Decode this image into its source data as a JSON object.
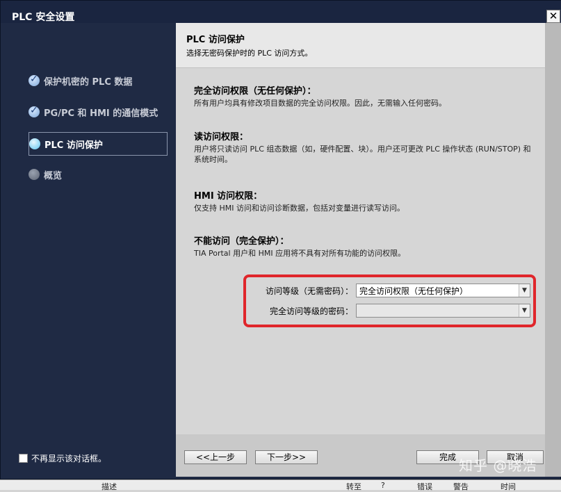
{
  "window": {
    "title": "PLC 安全设置",
    "close_label": "✕"
  },
  "sidebar": {
    "items": [
      {
        "label": "保护机密的 PLC 数据",
        "state": "done"
      },
      {
        "label": "PG/PC 和 HMI 的通信模式",
        "state": "done"
      },
      {
        "label": "PLC 访问保护",
        "state": "active"
      },
      {
        "label": "概览",
        "state": "pending"
      }
    ],
    "dont_show_label": "不再显示该对话框。"
  },
  "header": {
    "title": "PLC 访问保护",
    "subtitle": "选择无密码保护时的 PLC 访问方式。"
  },
  "sections": [
    {
      "title": "完全访问权限（无任何保护）：",
      "desc": "所有用户均具有修改项目数据的完全访问权限。因此，无需输入任何密码。"
    },
    {
      "title": "读访问权限：",
      "desc": "用户将只读访问 PLC 组态数据（如，硬件配置、块）。用户还可更改 PLC 操作状态 (RUN/STOP) 和系统时间。"
    },
    {
      "title": "HMI 访问权限：",
      "desc": "仅支持 HMI 访问和访问诊断数据，包括对变量进行读写访问。"
    },
    {
      "title": "不能访问（完全保护）：",
      "desc": "TIA Portal 用户和 HMI 应用将不具有对所有功能的访问权限。"
    }
  ],
  "form": {
    "level_label": "访问等级（无需密码）：",
    "level_value": "完全访问权限（无任何保护）",
    "password_label": "完全访问等级的密码：",
    "password_value": ""
  },
  "buttons": {
    "prev": "<<上一步",
    "next": "下一步>>",
    "finish": "完成",
    "cancel": "取消"
  },
  "watermark": "知乎 @晓浩",
  "statusbar": {
    "description": "描述",
    "goto": "转至",
    "question": "?",
    "errors": "错误",
    "warnings": "警告",
    "time": "时间"
  },
  "colors": {
    "highlight_border": "#e0262b",
    "sidebar_bg": "#1f2a44"
  }
}
